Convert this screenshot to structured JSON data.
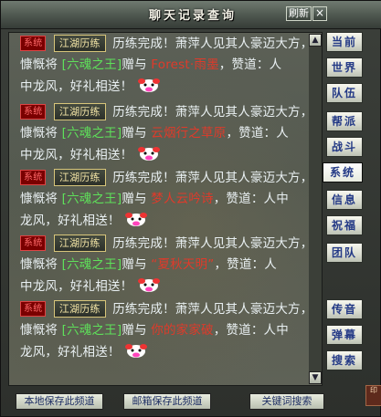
{
  "window": {
    "title": "聊天记录查询",
    "refresh_label": "刷新",
    "close_label": "×"
  },
  "sidebar": {
    "tabs": [
      {
        "label": "当前"
      },
      {
        "label": "世界"
      },
      {
        "label": "队伍"
      },
      {
        "label": "帮派"
      },
      {
        "label": "战斗"
      },
      {
        "label": "系统",
        "active": true
      },
      {
        "label": "信息"
      },
      {
        "label": "祝福"
      },
      {
        "label": "团队"
      },
      {
        "label": "传音"
      },
      {
        "label": "弹幕"
      },
      {
        "label": "搜索"
      }
    ]
  },
  "messages": [
    {
      "channel": "系统",
      "tag": "江湖历练",
      "lines": [
        "历练完成！萧萍人见其人豪迈大方，慷慨将",
        "[六魂之王]",
        "赠与",
        "Forest·雨墨",
        "，赞道：人",
        "中龙风，好礼相送！"
      ]
    },
    {
      "channel": "系统",
      "tag": "江湖历练",
      "lines": [
        "历练完成！萧萍人见其人豪迈大方，慷慨将",
        "[六魂之王]",
        "赠与",
        "云烟行之草原",
        "，赞道：人",
        "中龙风，好礼相送！"
      ]
    },
    {
      "channel": "系统",
      "tag": "江湖历练",
      "lines": [
        "历练完成！萧萍人见其人豪迈大方，慷慨将",
        "[六魂之王]",
        "赠与",
        "梦人云吟诗",
        "，赞道：人中",
        "龙风，好礼相送！"
      ]
    },
    {
      "channel": "系统",
      "tag": "江湖历练",
      "lines": [
        "历练完成！萧萍人见其人豪迈大方，慷慨将",
        "[六魂之王]",
        "赠与",
        "“夏秋天明”",
        "，赞道：人",
        "中龙风，好礼相送！"
      ]
    },
    {
      "channel": "系统",
      "tag": "江湖历练",
      "lines": [
        "历练完成！萧萍人见其人豪迈大方，慷慨将",
        "[六魂之王]",
        "赠与",
        "你的家家破",
        "，赞道：人中",
        "龙风，好礼相送！"
      ]
    }
  ],
  "footer": {
    "buttons": [
      "本地保存此频道",
      "邮箱保存此频道",
      "关键词搜索"
    ]
  },
  "icons": {
    "emoji": "cow-face-icon",
    "scroll_up": "chevron-up-icon",
    "scroll_down": "chevron-down-icon",
    "seal": "seal-icon"
  },
  "colors": {
    "system_badge": "#7a0000",
    "item_name": "#5ee05a",
    "player_name": "#e03a2a",
    "sidebar_text": "#243a86"
  }
}
